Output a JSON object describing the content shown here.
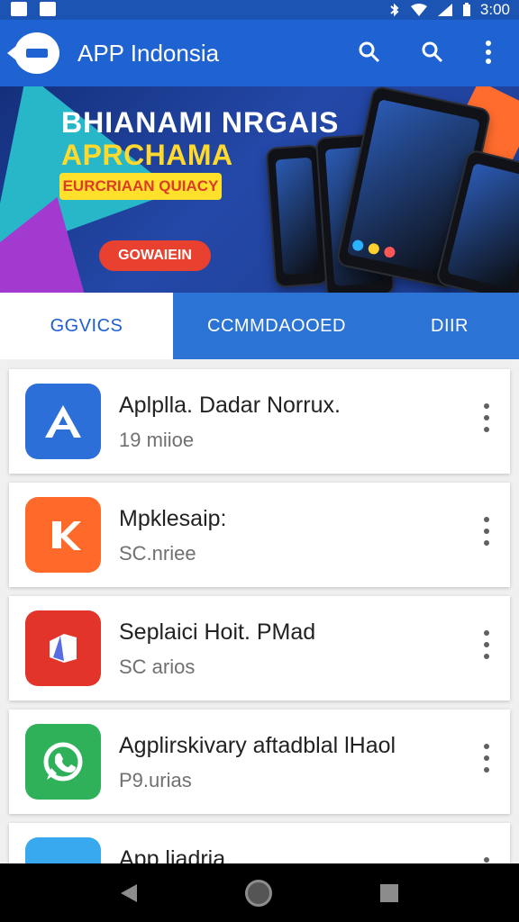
{
  "status_bar": {
    "time": "3:00",
    "icons": [
      "image-icon",
      "gallery-icon",
      "bluetooth-icon",
      "wifi-icon",
      "signal-icon",
      "battery-icon"
    ]
  },
  "app_bar": {
    "title": "APP Indonsia",
    "icons": [
      "back-logo-icon",
      "search-icon",
      "search-icon",
      "more-vert-icon"
    ]
  },
  "banner": {
    "headline_line1": "BHIANAMI NRGAIS",
    "headline_line2": "APRCHAMA",
    "badge": "EURCRIAAN QUIACY",
    "cta": "GOWAIEIN"
  },
  "tabs": {
    "items": [
      {
        "label": "GGVICS",
        "active": true
      },
      {
        "label": "CCMMDAOOED",
        "active": false
      },
      {
        "label": "DIIR",
        "active": false
      }
    ]
  },
  "apps": [
    {
      "name": "Aplplla. Dadar Norrux.",
      "subtitle": "19 miioe",
      "icon": "a-letter-icon",
      "color": "#2c6fd8"
    },
    {
      "name": "Mpklesaip:",
      "subtitle": "SC.nriee",
      "icon": "k-letter-icon",
      "color": "#ff6a2a"
    },
    {
      "name": "Seplaici Hoit. PMad",
      "subtitle": "SC arios",
      "icon": "folded-paper-icon",
      "color": "#e3342b"
    },
    {
      "name": "Agplirskivary aftadblal lHaol",
      "subtitle": "P9.urias",
      "icon": "whatsapp-icon",
      "color": "#2fb15a"
    },
    {
      "name": "App liadria",
      "subtitle": "",
      "icon": "blue-app-icon",
      "color": "#38a9ef"
    }
  ],
  "nav_bar": {
    "buttons": [
      "back-triangle-icon",
      "home-circle-icon",
      "recent-square-icon"
    ]
  }
}
